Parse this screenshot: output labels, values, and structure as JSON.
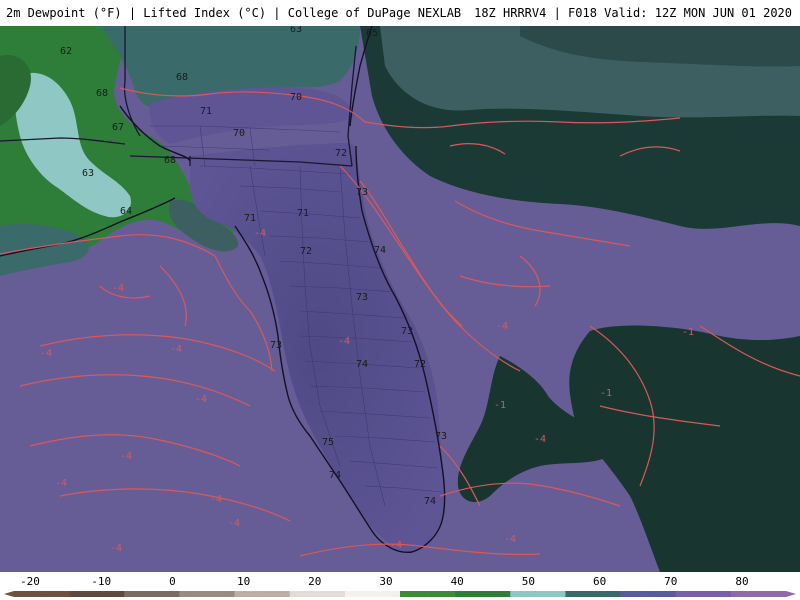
{
  "header": {
    "title": "2m Dewpoint (°F) | Lifted Index (°C) | College of DuPage NEXLAB",
    "run_info": "18Z HRRRV4 | F018 Valid: 12Z MON JUN 01 2020"
  },
  "map": {
    "dewpoint_labels": [
      "63",
      "65",
      "62",
      "68",
      "68",
      "67",
      "71",
      "70",
      "70",
      "72",
      "68",
      "63",
      "64",
      "73",
      "71",
      "71",
      "72",
      "74",
      "73",
      "73",
      "72",
      "74",
      "73",
      "75",
      "73",
      "74",
      "74"
    ],
    "lifted_index_labels": [
      "-4",
      "-4",
      "-4",
      "-4",
      "-4",
      "-4",
      "-4",
      "-4",
      "-4",
      "-4",
      "-4",
      "-4",
      "-1",
      "-1",
      "-1",
      "-4",
      "-4",
      "-4"
    ]
  },
  "colorbar": {
    "ticks": [
      "-20",
      "-10",
      "0",
      "10",
      "20",
      "30",
      "40",
      "50",
      "60",
      "70",
      "80"
    ],
    "colors": [
      "#6e5040",
      "#5c4a3e",
      "#7a6c60",
      "#9a8c80",
      "#bab0a6",
      "#e0dcd8",
      "#f4f2ef",
      "#3f8a3a",
      "#2e7e3a",
      "#8fc7c5",
      "#3a6a68",
      "#5a5aa0",
      "#7860a8",
      "#8f6aa8"
    ]
  },
  "colors": {
    "gulf_purple": "#665d96",
    "land_purple": "#5c5390",
    "atlantic_dark": "#183530",
    "teal": "#3a6a6a",
    "li_contour": "#d9585c"
  }
}
